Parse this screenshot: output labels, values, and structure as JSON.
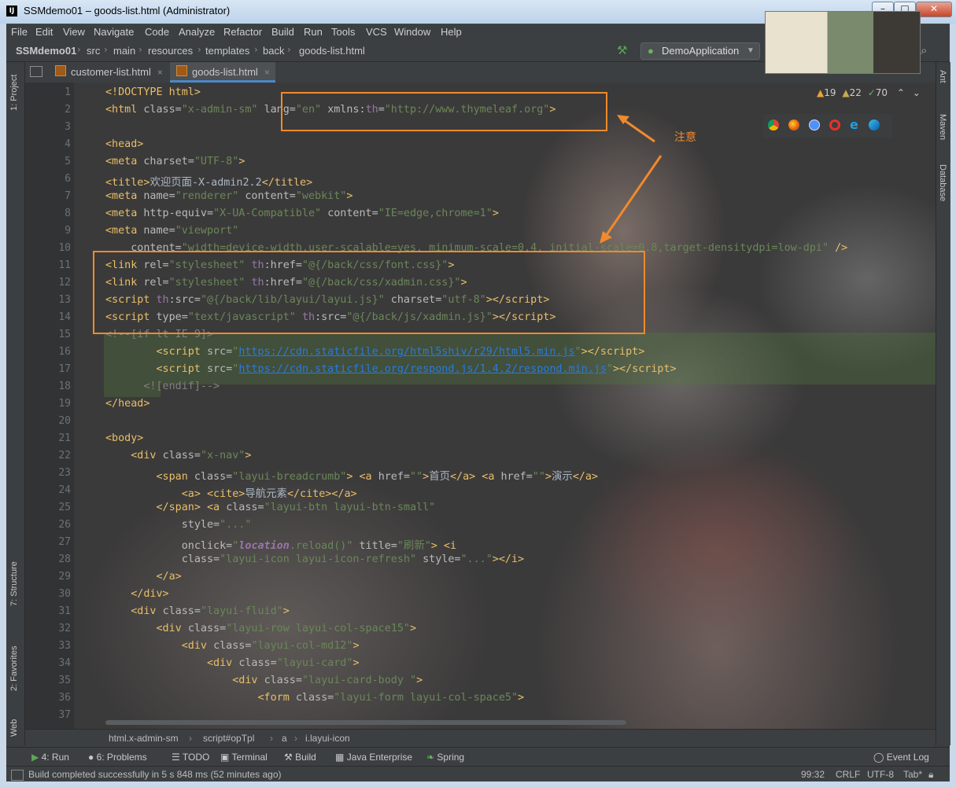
{
  "window": {
    "title": "SSMdemo01 – goods-list.html (Administrator)",
    "logo_text": "IJ",
    "controls": [
      "–",
      "□",
      "✕"
    ]
  },
  "menu": [
    "File",
    "Edit",
    "View",
    "Navigate",
    "Code",
    "Analyze",
    "Refactor",
    "Build",
    "Run",
    "Tools",
    "VCS",
    "Window",
    "Help"
  ],
  "breadcrumbs": [
    "SSMdemo01",
    "src",
    "main",
    "resources",
    "templates",
    "back",
    "goods-list.html"
  ],
  "run_config": "DemoApplication",
  "tabs": [
    {
      "label": "customer-list.html",
      "active": false
    },
    {
      "label": "goods-list.html",
      "active": true
    }
  ],
  "left_tools": [
    "1: Project",
    "7: Structure",
    "2: Favorites",
    "Web"
  ],
  "right_tools": [
    "Ant",
    "Maven",
    "Database"
  ],
  "inspections": {
    "warnings": "19",
    "weak_warnings": "22",
    "typos": "70"
  },
  "line_numbers": [
    "1",
    "2",
    "3",
    "4",
    "5",
    "6",
    "7",
    "8",
    "9",
    "10",
    "11",
    "12",
    "13",
    "14",
    "15",
    "16",
    "17",
    "18",
    "19",
    "20",
    "21",
    "22",
    "23",
    "24",
    "25",
    "26",
    "27",
    "28",
    "29",
    "30",
    "31",
    "32",
    "33",
    "34",
    "35",
    "36",
    "37"
  ],
  "annotation": "注意",
  "code_breadcrumb": [
    "html.x-admin-sm",
    "script#opTpl",
    "a",
    "i.layui-icon"
  ],
  "bottom_tools": [
    "4: Run",
    "6: Problems",
    "TODO",
    "Terminal",
    "Build",
    "Java Enterprise",
    "Spring",
    "Event Log"
  ],
  "status": {
    "message": "Build completed successfully in 5 s 848 ms (52 minutes ago)",
    "position": "99:32",
    "line_sep": "CRLF",
    "encoding": "UTF-8",
    "indent": "Tab*"
  },
  "colors": {
    "accent": "#4a88c7",
    "annotation": "#f08a2c",
    "tag": "#e8bf6a",
    "string": "#6a8759"
  }
}
